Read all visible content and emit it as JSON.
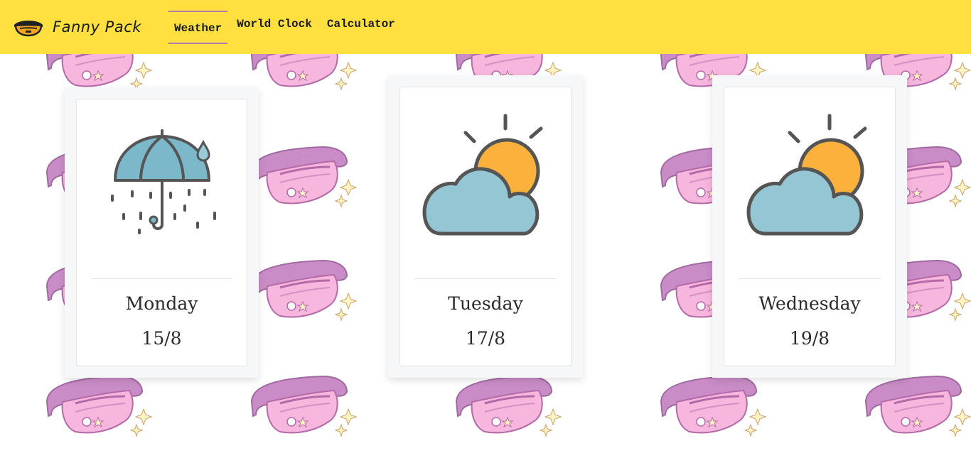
{
  "app": {
    "name": "Fanny Pack",
    "logo_icon": "fanny-pack-logo-icon"
  },
  "nav": {
    "items": [
      {
        "label": "Weather",
        "active": true
      },
      {
        "label": "World Clock",
        "active": false
      },
      {
        "label": "Calculator",
        "active": false
      }
    ]
  },
  "background": {
    "pattern_icon": "pink-fanny-pack-icon",
    "color": "#f7b6dd"
  },
  "colors": {
    "navbar": "#ffe03f",
    "active_underline": "#b07bb0"
  },
  "forecast": [
    {
      "day": "Monday",
      "date": "15/8",
      "icon": "umbrella-rain-icon"
    },
    {
      "day": "Tuesday",
      "date": "17/8",
      "icon": "partly-cloudy-icon"
    },
    {
      "day": "Wednesday",
      "date": "19/8",
      "icon": "partly-cloudy-icon"
    }
  ]
}
